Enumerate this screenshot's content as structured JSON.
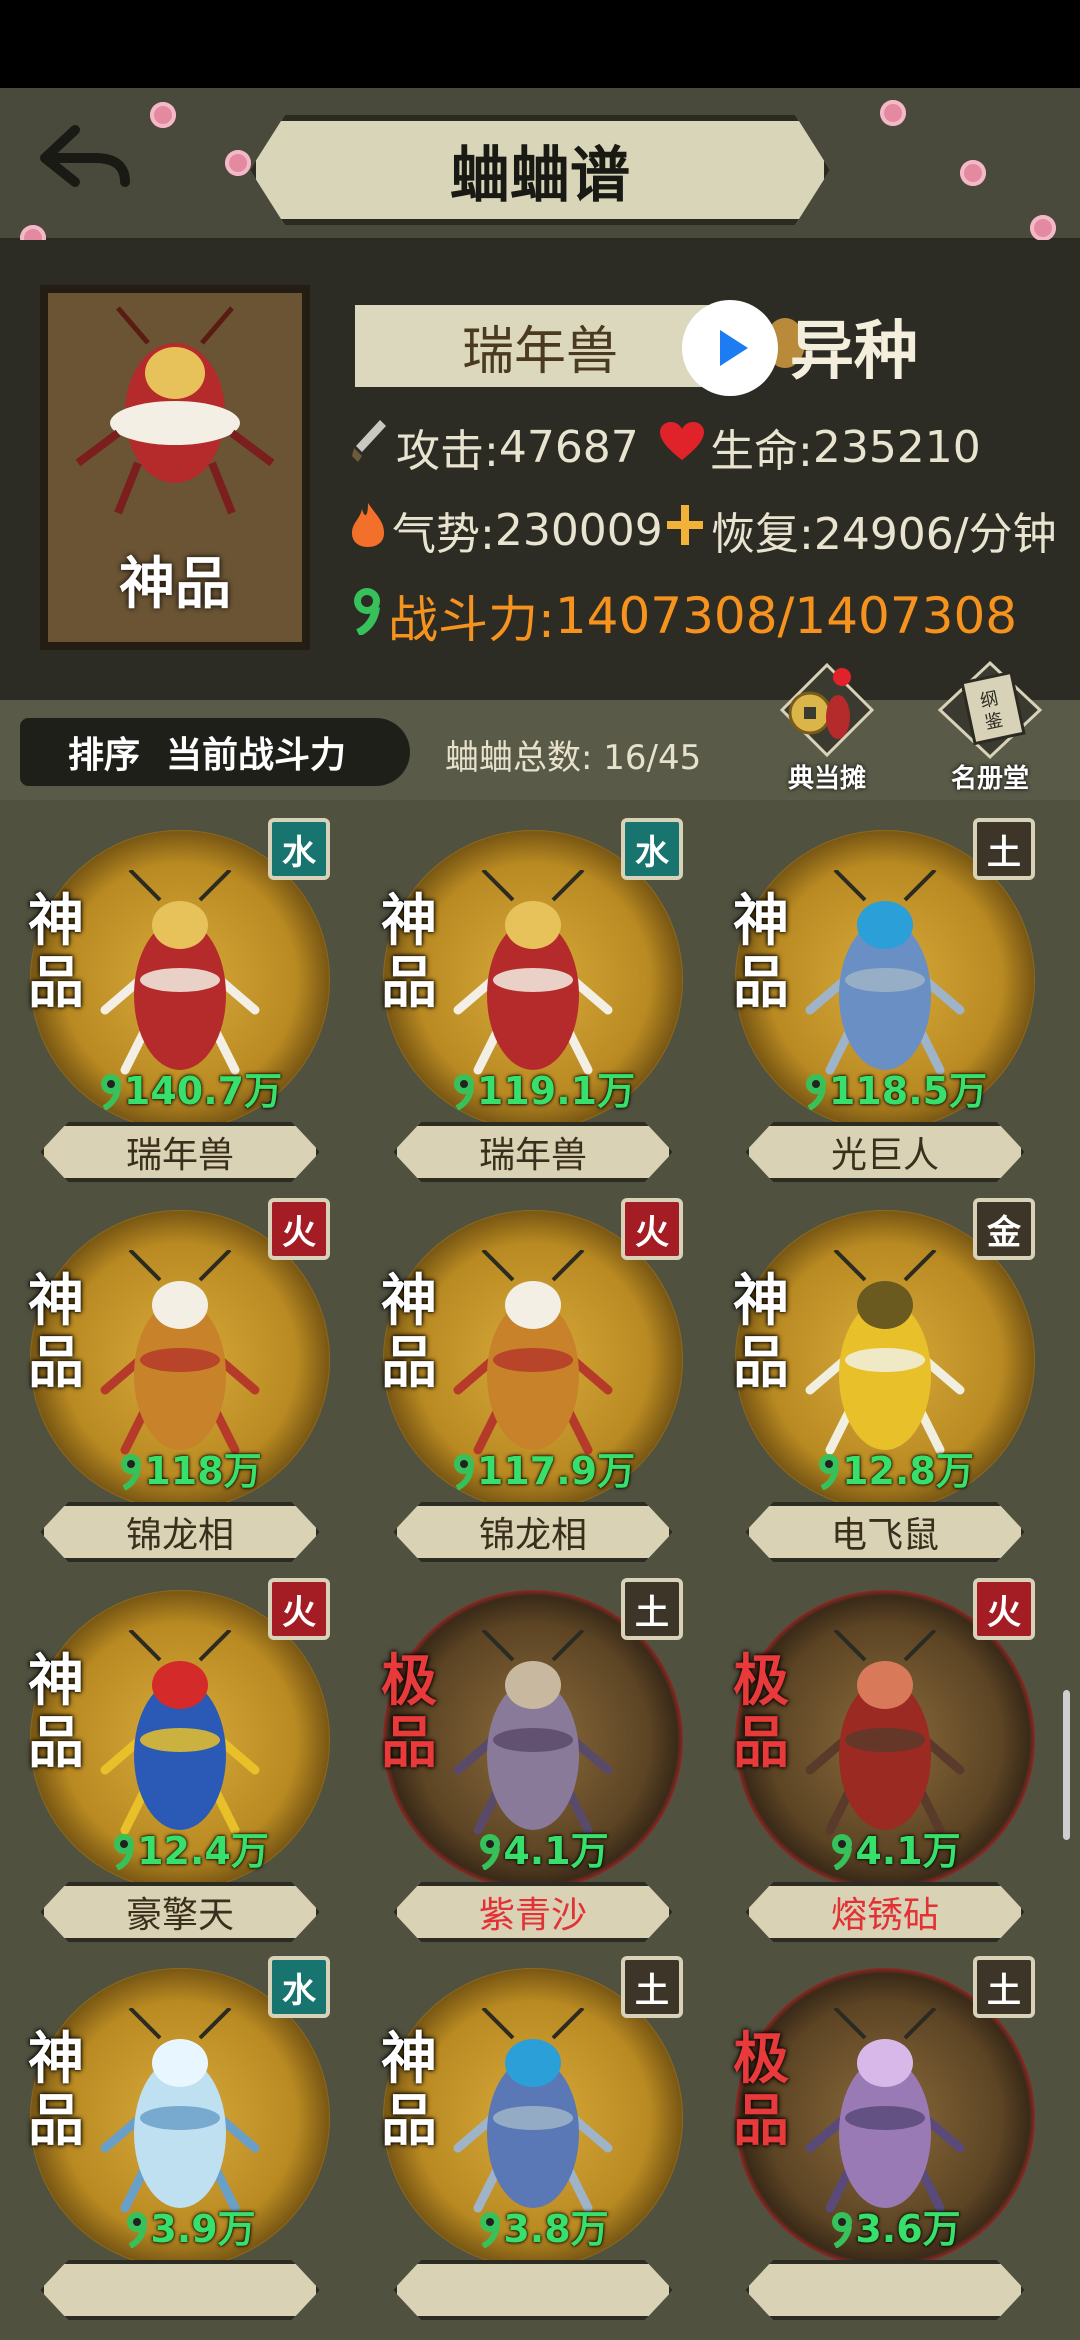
{
  "header": {
    "title": "蛐蛐谱"
  },
  "detail": {
    "grade": "神品",
    "name": "瑞年兽",
    "variant": "异种",
    "stats": {
      "attack_label": "攻击:",
      "attack": "47687",
      "hp_label": "生命:",
      "hp": "235210",
      "momentum_label": "气势:",
      "momentum": "230009",
      "recovery_label": "恢复:",
      "recovery": "24906/分钟",
      "power_label": "战斗力:",
      "power": "1407308/1407308"
    }
  },
  "toolbar": {
    "sort_label": "排序",
    "sort_value": "当前战斗力",
    "total_label": "蛐蛐总数:",
    "total_value": "16/45",
    "pawn_label": "典当摊",
    "roster_label": "名册堂"
  },
  "cards": [
    {
      "grade": "神品",
      "element": "水",
      "power": "140.7万",
      "name": "瑞年兽"
    },
    {
      "grade": "神品",
      "element": "水",
      "power": "119.1万",
      "name": "瑞年兽"
    },
    {
      "grade": "神品",
      "element": "土",
      "power": "118.5万",
      "name": "光巨人"
    },
    {
      "grade": "神品",
      "element": "火",
      "power": "118万",
      "name": "锦龙相"
    },
    {
      "grade": "神品",
      "element": "火",
      "power": "117.9万",
      "name": "锦龙相"
    },
    {
      "grade": "神品",
      "element": "金",
      "power": "12.8万",
      "name": "电飞鼠"
    },
    {
      "grade": "神品",
      "element": "火",
      "power": "12.4万",
      "name": "豪擎天"
    },
    {
      "grade": "极品",
      "element": "土",
      "power": "4.1万",
      "name": "紫青沙"
    },
    {
      "grade": "极品",
      "element": "火",
      "power": "4.1万",
      "name": "熔锈砧"
    },
    {
      "grade": "神品",
      "element": "水",
      "power": "3.9万",
      "name": ""
    },
    {
      "grade": "神品",
      "element": "土",
      "power": "3.8万",
      "name": ""
    },
    {
      "grade": "极品",
      "element": "土",
      "power": "3.6万",
      "name": ""
    }
  ],
  "colors": {
    "power_orange": "#f6921e",
    "card_power_green": "#37e06b",
    "water": "#17746e",
    "fire": "#a51d24",
    "earth": "#3d3527",
    "top_grade_red": "#e23236"
  }
}
